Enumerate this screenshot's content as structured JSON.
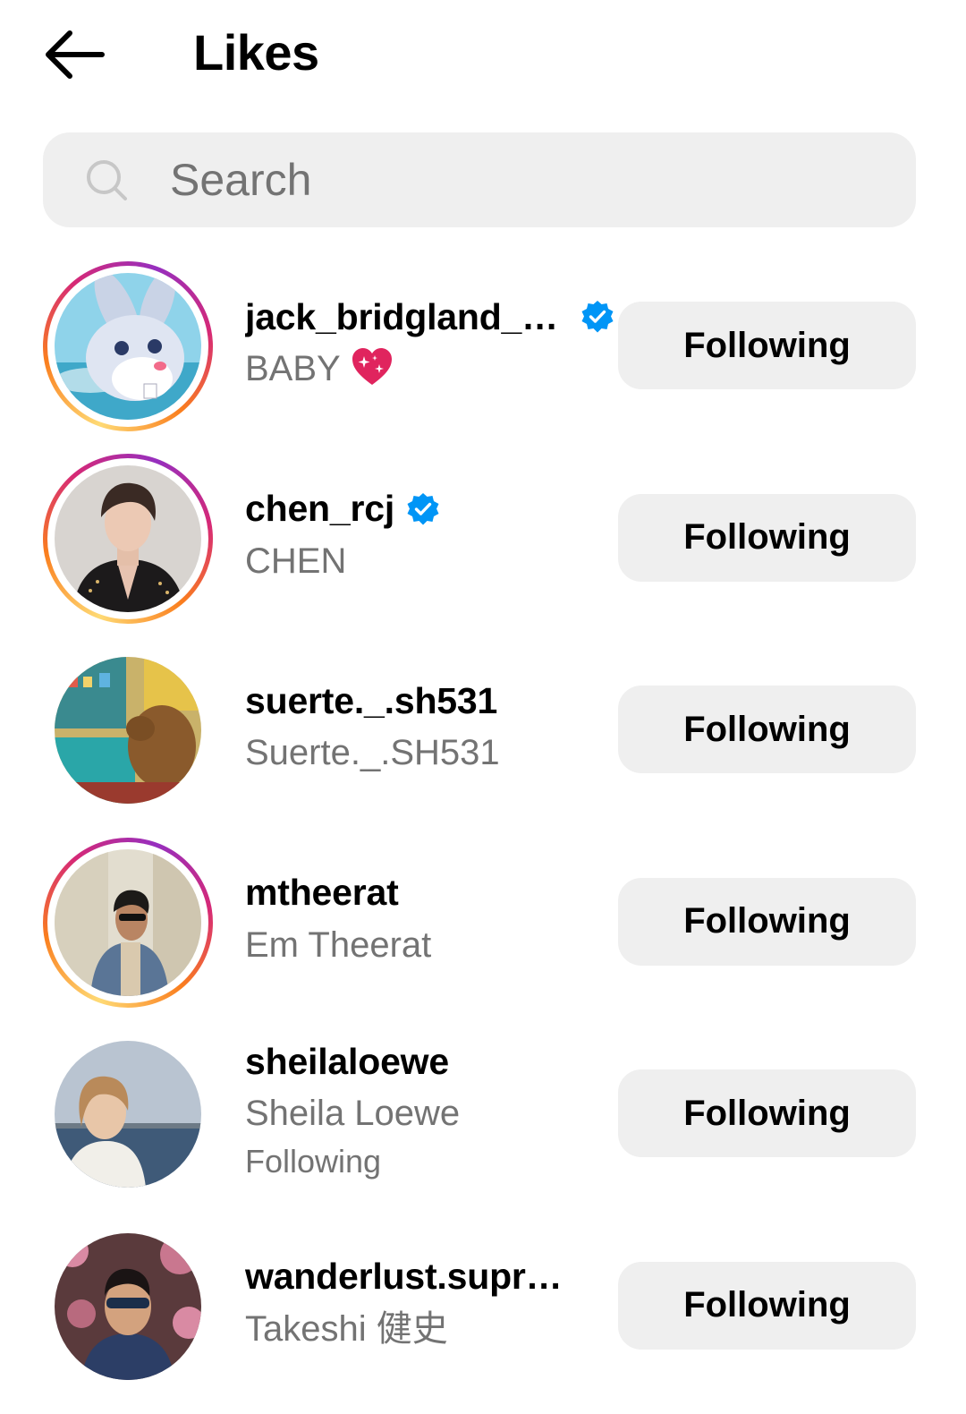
{
  "header": {
    "title": "Likes",
    "back_icon": "arrow-left-icon"
  },
  "search": {
    "placeholder": "Search",
    "value": "",
    "icon": "search-icon"
  },
  "users": [
    {
      "username": "jack_bridgland_st...",
      "full_name": "BABY",
      "verified": true,
      "has_story_ring": true,
      "emoji": "sparkling-heart-icon",
      "button_label": "Following"
    },
    {
      "username": "chen_rcj",
      "full_name": "CHEN",
      "verified": true,
      "has_story_ring": true,
      "button_label": "Following"
    },
    {
      "username": "suerte._.sh531",
      "full_name": "Suerte._.SH531",
      "verified": false,
      "has_story_ring": false,
      "button_label": "Following"
    },
    {
      "username": "mtheerat",
      "full_name": "Em Theerat",
      "verified": false,
      "has_story_ring": true,
      "button_label": "Following"
    },
    {
      "username": "sheilaloewe",
      "full_name": "Sheila Loewe",
      "subtext": "Following",
      "verified": false,
      "has_story_ring": false,
      "button_label": "Following"
    },
    {
      "username": "wanderlust.supreme",
      "full_name": "Takeshi 健史",
      "verified": false,
      "has_story_ring": false,
      "button_label": "Following"
    }
  ],
  "colors": {
    "verified_blue": "#0095f6",
    "secondary_text": "#737373",
    "button_bg": "#efefef",
    "heart_red": "#e0245e"
  }
}
